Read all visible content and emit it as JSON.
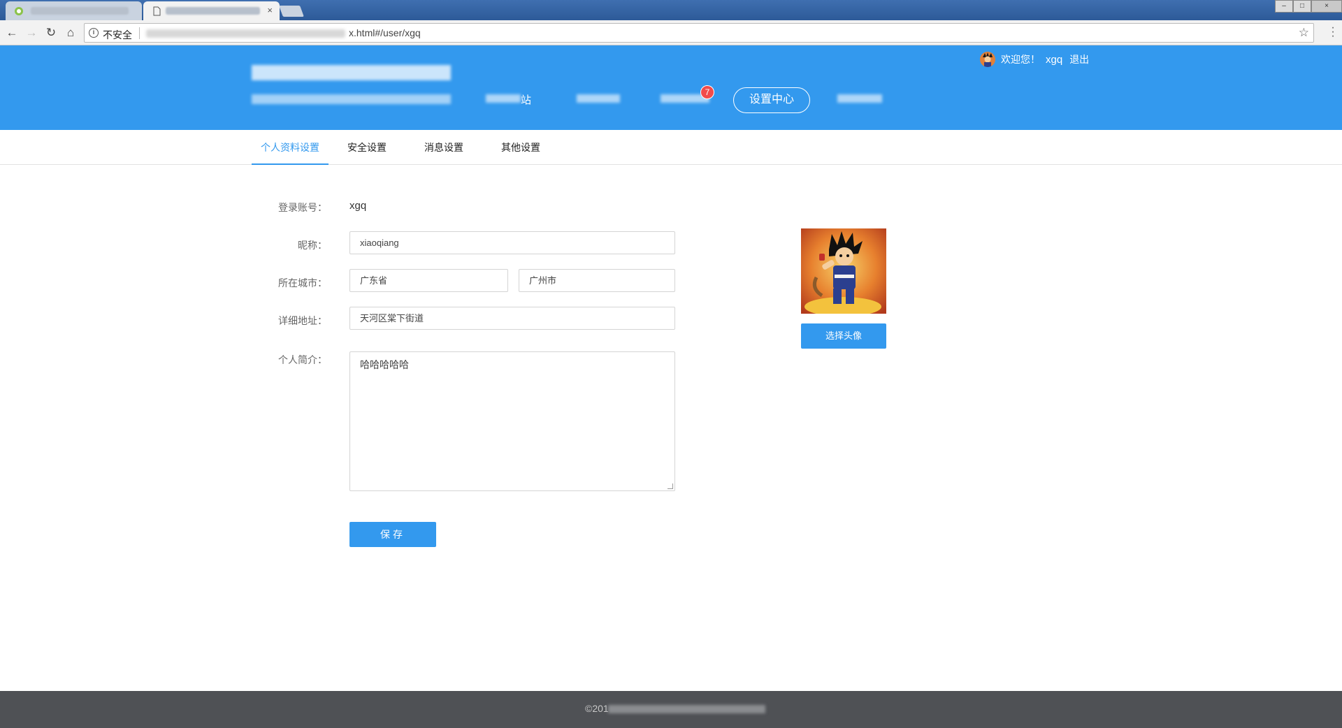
{
  "browser": {
    "active_tab_close": "×",
    "security_label": "不安全",
    "url_visible": "x.html#/user/xgq",
    "window_controls": {
      "minimize": "–",
      "maximize": "□",
      "close": "×"
    }
  },
  "header": {
    "nav_partial_label": "站",
    "notification_count": "7",
    "settings_center_label": "设置中心",
    "welcome_text": "欢迎您！",
    "username": "xgq",
    "logout_label": "退出"
  },
  "tabs": [
    {
      "label": "个人资料设置",
      "active": true
    },
    {
      "label": "安全设置",
      "active": false
    },
    {
      "label": "消息设置",
      "active": false
    },
    {
      "label": "其他设置",
      "active": false
    }
  ],
  "form": {
    "account_label": "登录账号：",
    "account_value": "xgq",
    "nickname_label": "昵称：",
    "nickname_value": "xiaoqiang",
    "city_label": "所在城市：",
    "province_value": "广东省",
    "city_value": "广州市",
    "address_label": "详细地址：",
    "address_value": "天河区棠下街道",
    "bio_label": "个人简介：",
    "bio_value": "哈哈哈哈哈",
    "save_label": "保存"
  },
  "avatar": {
    "choose_label": "选择头像"
  },
  "footer": {
    "copyright_prefix": "©201"
  },
  "colors": {
    "primary": "#3399ee",
    "badge": "#f24b4b",
    "footer_bg": "#4f5155"
  }
}
